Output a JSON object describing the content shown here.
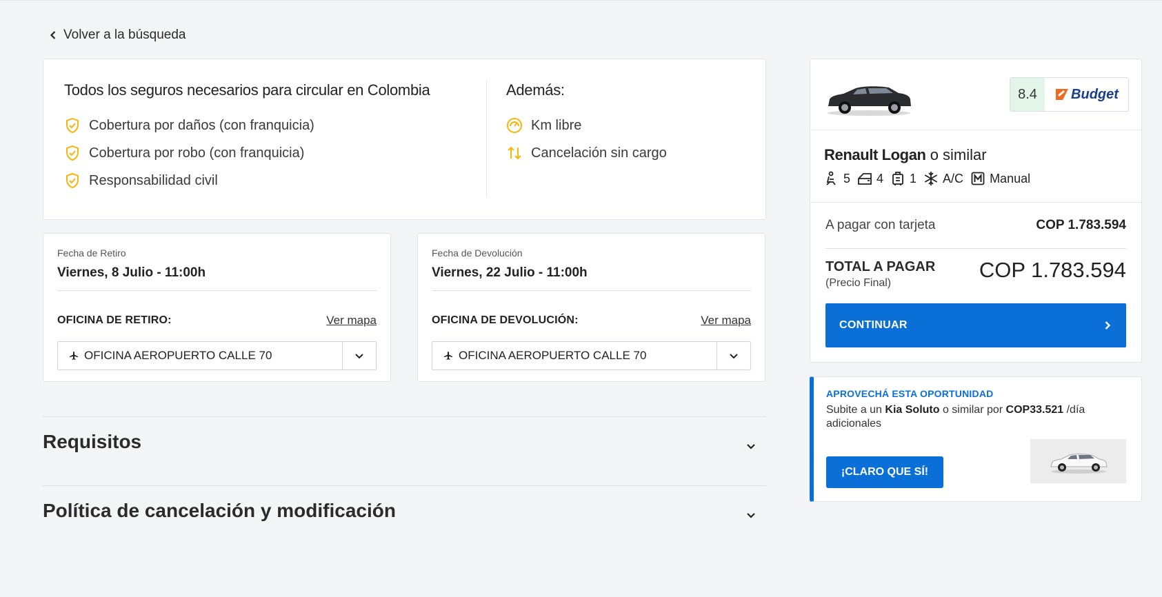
{
  "back": {
    "label": "Volver a la búsqueda"
  },
  "coverage": {
    "title": "Todos los seguros necesarios para circular en Colombia",
    "items": [
      "Cobertura por daños (con franquicia)",
      "Cobertura por robo (con franquicia)",
      "Responsabilidad civil"
    ],
    "extra_title": "Además:",
    "extra_items": [
      "Km libre",
      "Cancelación sin cargo"
    ]
  },
  "pickup": {
    "label": "Fecha de Retiro",
    "value": "Viernes, 8 Julio - 11:00h",
    "office_label": "OFICINA DE RETIRO:",
    "map_link": "Ver mapa",
    "office": "OFICINA AEROPUERTO CALLE 70"
  },
  "dropoff": {
    "label": "Fecha de Devolución",
    "value": "Viernes, 22 Julio - 11:00h",
    "office_label": "OFICINA DE DEVOLUCIÓN:",
    "map_link": "Ver mapa",
    "office": "OFICINA AEROPUERTO CALLE 70"
  },
  "accordions": {
    "requirements": "Requisitos",
    "policy": "Política de cancelación y modificación"
  },
  "summary": {
    "rating": "8.4",
    "brand": "Budget",
    "car_model": "Renault Logan",
    "car_suffix": " o similar",
    "features": {
      "seats": "5",
      "doors": "4",
      "bags": "1",
      "ac": "A/C",
      "transmission": "Manual"
    },
    "pay_label": "A pagar con tarjeta",
    "pay_value": "COP 1.783.594",
    "total_label": "TOTAL A PAGAR",
    "total_sub": "(Precio Final)",
    "total_value": "COP 1.783.594",
    "cta": "CONTINUAR"
  },
  "upsell": {
    "title": "APROVECHÁ ESTA OPORTUNIDAD",
    "text_prefix": "Subite a un ",
    "car": "Kia Soluto",
    "text_mid": " o similar por ",
    "price": "COP33.521",
    "text_suffix": " /día adicionales",
    "button": "¡CLARO QUE SÍ!"
  },
  "colors": {
    "accent": "#0a6fd6",
    "shield": "#f5b60b",
    "rating_bg": "#e2f5e8",
    "brand": "#1a3e8c",
    "brand_mark": "#f26a21"
  }
}
